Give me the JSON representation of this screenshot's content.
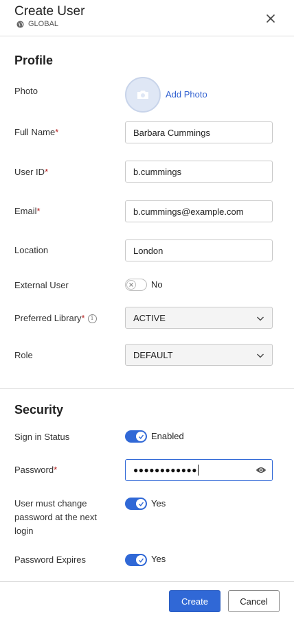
{
  "header": {
    "title": "Create User",
    "scope": "GLOBAL"
  },
  "profile": {
    "section_title": "Profile",
    "photo_label": "Photo",
    "add_photo": "Add Photo",
    "full_name_label": "Full Name",
    "full_name_value": "Barbara Cummings",
    "user_id_label": "User ID",
    "user_id_value": "b.cummings",
    "email_label": "Email",
    "email_value": "b.cummings@example.com",
    "location_label": "Location",
    "location_value": "London",
    "external_user_label": "External User",
    "external_user_state": "No",
    "preferred_library_label": "Preferred Library",
    "preferred_library_value": "ACTIVE",
    "role_label": "Role",
    "role_value": "DEFAULT",
    "required_marker": "*"
  },
  "security": {
    "section_title": "Security",
    "sign_in_status_label": "Sign in Status",
    "sign_in_status_state": "Enabled",
    "password_label": "Password",
    "password_mask": "●●●●●●●●●●●●",
    "must_change_label": "User must change password at the next login",
    "must_change_state": "Yes",
    "password_expires_label": "Password Expires",
    "password_expires_state": "Yes"
  },
  "footer": {
    "create_label": "Create",
    "cancel_label": "Cancel"
  },
  "colors": {
    "accent": "#3068d6",
    "required": "#b52323",
    "link": "#2f5fd0"
  },
  "icons": {
    "scope": "globe-icon",
    "close": "close-icon",
    "photo": "camera-icon",
    "info": "info-icon",
    "dropdown": "chevron-down-icon",
    "toggle_on": "check-icon",
    "toggle_off": "x-icon",
    "reveal": "eye-icon"
  }
}
